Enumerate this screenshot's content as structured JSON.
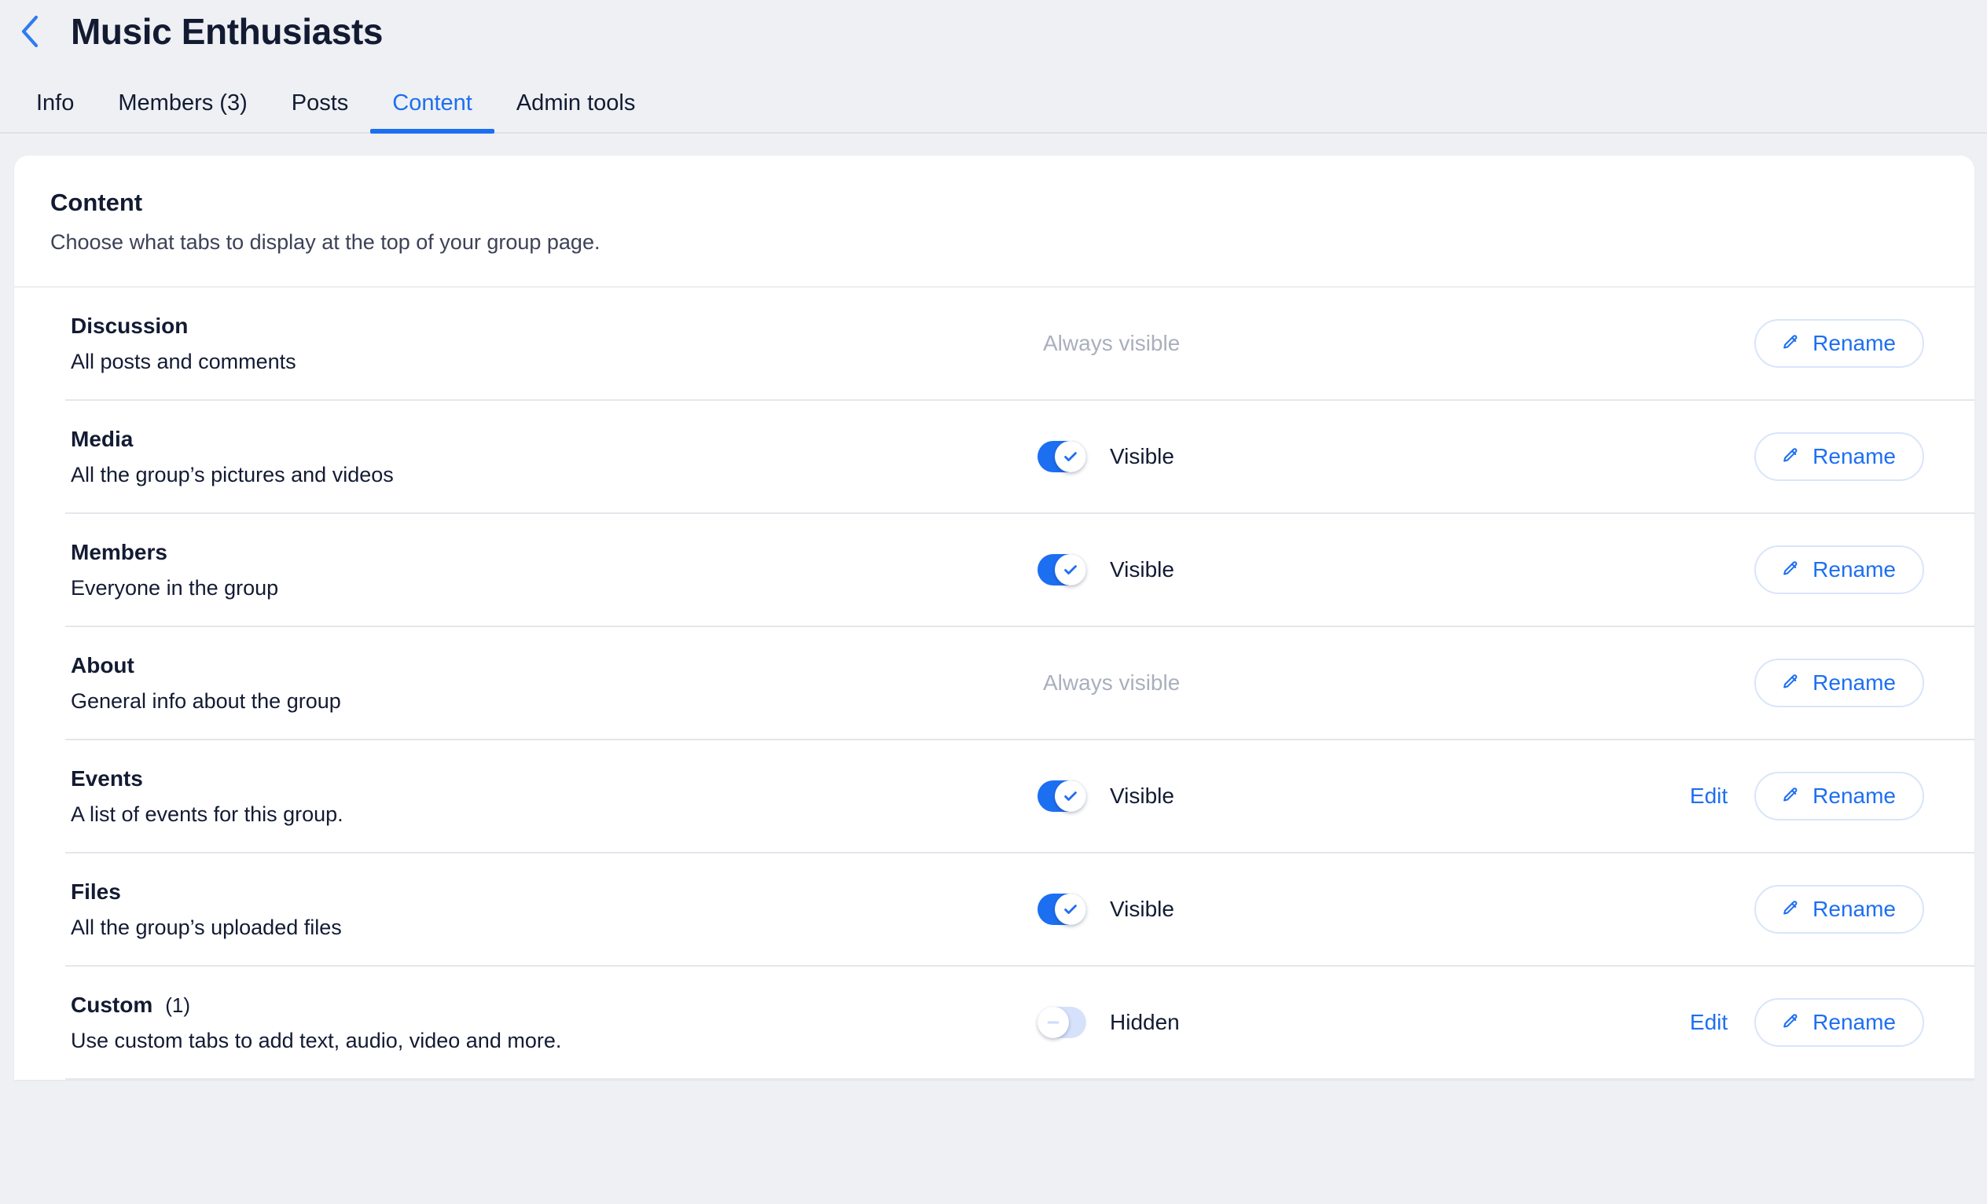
{
  "header": {
    "back_icon": "chevron-left-icon",
    "title": "Music Enthusiasts"
  },
  "tabs": [
    {
      "label": "Info",
      "active": false
    },
    {
      "label": "Members (3)",
      "active": false
    },
    {
      "label": "Posts",
      "active": false
    },
    {
      "label": "Content",
      "active": true
    },
    {
      "label": "Admin tools",
      "active": false
    }
  ],
  "card": {
    "title": "Content",
    "subtitle": "Choose what tabs to display at the top of your group page."
  },
  "labels": {
    "rename": "Rename",
    "edit": "Edit",
    "rename_icon": "pencil-icon"
  },
  "colors": {
    "accent": "#1d6ff2",
    "toggle_on": "#1d6ff2",
    "toggle_off": "#d6e2fb",
    "text": "#131b33",
    "muted": "#a9afbd",
    "page_bg": "#eef0f3",
    "card_bg": "#ffffff",
    "divider": "#e4e7ec"
  },
  "rows": [
    {
      "name": "Discussion",
      "count": "",
      "desc": "All posts and comments",
      "state_type": "always",
      "state_text": "Always visible",
      "toggle_on": false,
      "has_edit": false
    },
    {
      "name": "Media",
      "count": "",
      "desc": "All the group’s pictures and videos",
      "state_type": "toggle",
      "state_text": "Visible",
      "toggle_on": true,
      "has_edit": false
    },
    {
      "name": "Members",
      "count": "",
      "desc": "Everyone in the group",
      "state_type": "toggle",
      "state_text": "Visible",
      "toggle_on": true,
      "has_edit": false
    },
    {
      "name": "About",
      "count": "",
      "desc": "General info about the group",
      "state_type": "always",
      "state_text": "Always visible",
      "toggle_on": false,
      "has_edit": false
    },
    {
      "name": "Events",
      "count": "",
      "desc": "A list of events for this group.",
      "state_type": "toggle",
      "state_text": "Visible",
      "toggle_on": true,
      "has_edit": true
    },
    {
      "name": "Files",
      "count": "",
      "desc": "All the group’s uploaded files",
      "state_type": "toggle",
      "state_text": "Visible",
      "toggle_on": true,
      "has_edit": false
    },
    {
      "name": "Custom",
      "count": "(1)",
      "desc": "Use custom tabs to add text, audio, video and more.",
      "state_type": "toggle",
      "state_text": "Hidden",
      "toggle_on": false,
      "has_edit": true
    }
  ]
}
